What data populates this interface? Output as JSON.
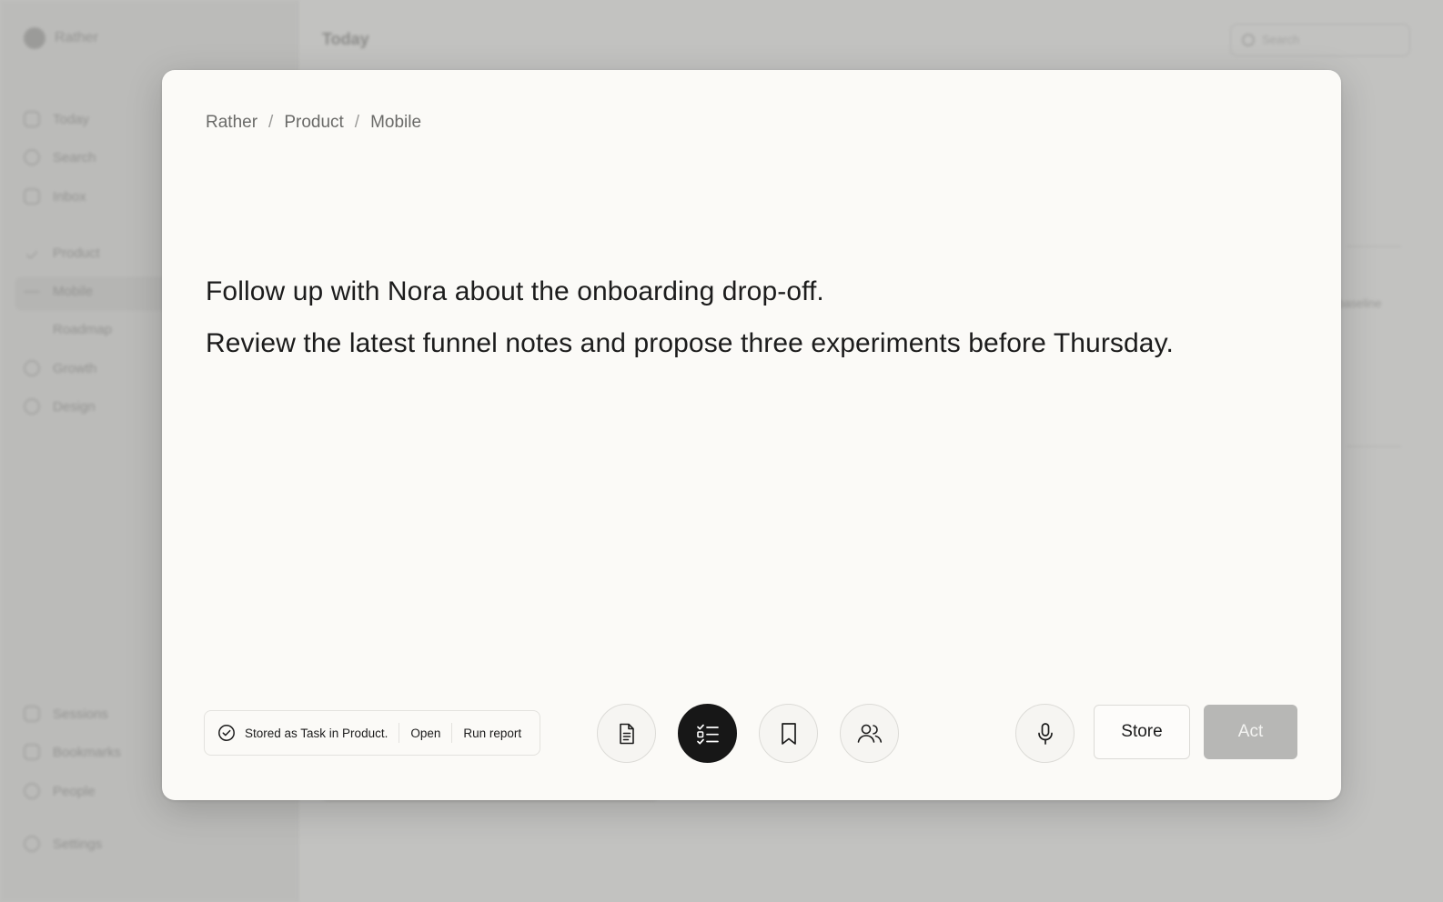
{
  "background": {
    "brand": "Rather",
    "page_title": "Today",
    "search_placeholder": "Search",
    "nav": [
      {
        "label": "Today",
        "icon": "calendar-icon"
      },
      {
        "label": "Search",
        "icon": "search-icon"
      },
      {
        "label": "Inbox",
        "icon": "inbox-icon"
      },
      {
        "label": "Product",
        "icon": "check-icon"
      },
      {
        "label": "Mobile",
        "icon": "chevron-icon"
      },
      {
        "label": "Roadmap",
        "icon": ""
      },
      {
        "label": "Growth",
        "icon": "folder-icon"
      },
      {
        "label": "Design",
        "icon": "folder-icon"
      }
    ],
    "bottom_nav": [
      {
        "label": "Sessions",
        "icon": "sessions-icon"
      },
      {
        "label": "Bookmarks",
        "icon": "bookmark-icon"
      },
      {
        "label": "People",
        "icon": "people-icon"
      },
      {
        "label": "Settings",
        "icon": "gear-icon"
      }
    ],
    "side_text": "baseline"
  },
  "modal": {
    "breadcrumb": [
      "Rather",
      "Product",
      "Mobile"
    ],
    "breadcrumb_separator": "/",
    "content": {
      "line1": "Follow up with Nora about the onboarding drop-off.",
      "line2": "Review the latest funnel notes and propose three experiments before Thursday."
    },
    "status": {
      "text": "Stored as Task in Product.",
      "open_label": "Open",
      "run_report_label": "Run report"
    },
    "modes": [
      {
        "name": "note",
        "icon": "document-icon",
        "active": false
      },
      {
        "name": "task",
        "icon": "checklist-icon",
        "active": true
      },
      {
        "name": "bookmark",
        "icon": "bookmark-icon",
        "active": false
      },
      {
        "name": "people",
        "icon": "people-icon",
        "active": false
      }
    ],
    "store_label": "Store",
    "act_label": "Act",
    "colors": {
      "modal_bg": "#fbfaf7",
      "active_mode": "#171717",
      "act_disabled": "#b7b7b5",
      "backdrop": "#c2c2c0"
    }
  }
}
